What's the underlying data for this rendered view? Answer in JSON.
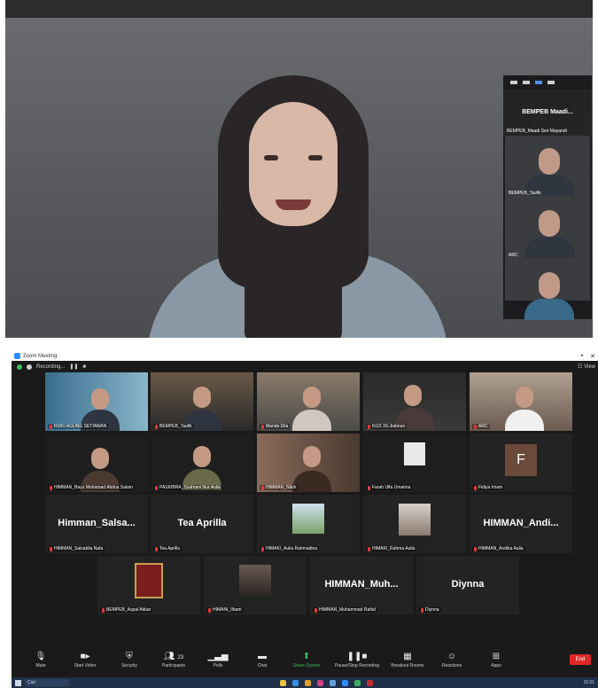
{
  "speaker_view": {
    "top_label": "",
    "filmstrip": {
      "name_tile_big": "BEMPEB Maadi...",
      "name_tile_small": "BEMPEB_Maadi Seri Mayandi",
      "tiles": [
        {
          "name": "BEMPEB_Taufik"
        },
        {
          "name": "ARC"
        },
        {
          "name": ""
        }
      ]
    }
  },
  "zoom": {
    "title": "Zoom Meeting",
    "recording_label": "Recording...",
    "view_label": "View",
    "gallery": {
      "row1": [
        {
          "name": "RIZKI AGUNG SETIAWAN",
          "active": false
        },
        {
          "name": "BEMPEB_Taufik",
          "active": true
        },
        {
          "name": "Manda Dila",
          "active": false
        },
        {
          "name": "KGS 3S-Jiabnun",
          "active": false
        },
        {
          "name": "ARC",
          "active": false
        }
      ],
      "row2": [
        {
          "name": "HIMMAN_Bayu Mohamad Abdus Salam",
          "active": false
        },
        {
          "name": "PASKIBRA_Syahrani Nur Aulia",
          "active": false
        },
        {
          "name": "HIMMAN_Niluh",
          "active": false
        },
        {
          "name": "Farah Ulfa Umaima",
          "active": false
        },
        {
          "name": "Fidiya Imam",
          "active": false,
          "initial": "F"
        }
      ],
      "row3": [
        {
          "name": "HIMMAN_Salsabila Nafa",
          "big": "Himman_Salsa...",
          "active": false
        },
        {
          "name": "Tea Aprilla",
          "big": "Tea Aprilla",
          "active": false
        },
        {
          "name": "HIMAKI_Aulia Rahmadina",
          "active": false
        },
        {
          "name": "HIMAKI_Rahma Aulia",
          "active": false
        },
        {
          "name": "HIMMAN_Andika Aulia",
          "big": "HIMMAN_Andi...",
          "active": false
        }
      ],
      "row4": [
        {
          "name": "BEMPEB_Aqsal Akbar",
          "active": false
        },
        {
          "name": "HIMANI_Ilham",
          "active": false
        },
        {
          "name": "HIMMAN_Muhammad Rahid",
          "big": "HIMMAN_Muh...",
          "active": false
        },
        {
          "name": "Diynna",
          "big": "Diynna",
          "active": false
        }
      ]
    },
    "toolbar": {
      "mute": "Mute",
      "start_video": "Start Video",
      "security": "Security",
      "participants": "Participants",
      "participants_count": "23",
      "polls": "Polls",
      "chat": "Chat",
      "share_screen": "Share Screen",
      "pause_recording": "Pause/Stop Recording",
      "breakout_rooms": "Breakout Rooms",
      "reactions": "Reactions",
      "apps": "Apps",
      "end": "End"
    },
    "taskbar": {
      "search": "Cari",
      "clock": "15.01"
    },
    "colors": {
      "active_speaker": "#c6e24a",
      "end_button": "#e02828",
      "share_screen": "#3fbf5a",
      "zoom_blue": "#2d8cff"
    }
  }
}
